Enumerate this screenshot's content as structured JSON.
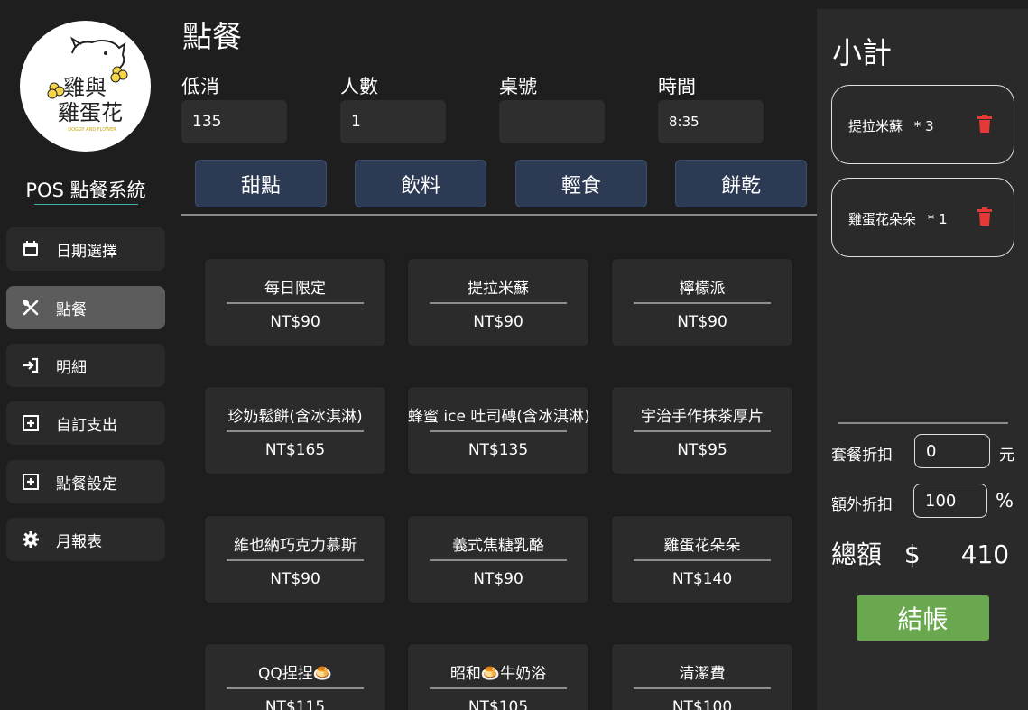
{
  "sidebar": {
    "logo_text": [
      "雞與",
      "雞蛋花"
    ],
    "logo_subtext": "DOGGY AND FLOWER",
    "title": "POS 點餐系統",
    "items": [
      {
        "label": "日期選擇",
        "icon": "calendar-icon",
        "active": false
      },
      {
        "label": "點餐",
        "icon": "utensils-icon",
        "active": true
      },
      {
        "label": "明細",
        "icon": "sign-in-icon",
        "active": false
      },
      {
        "label": "自訂支出",
        "icon": "plus-square-icon",
        "active": false
      },
      {
        "label": "點餐設定",
        "icon": "plus-square-icon",
        "active": false
      },
      {
        "label": "月報表",
        "icon": "gear-icon",
        "active": false
      }
    ]
  },
  "main": {
    "title": "點餐",
    "fields": [
      {
        "label": "低消",
        "value": "135"
      },
      {
        "label": "人數",
        "value": "1"
      },
      {
        "label": "桌號",
        "value": ""
      },
      {
        "label": "時間",
        "value": "8:35"
      }
    ],
    "categories": [
      "甜點",
      "飲料",
      "輕食",
      "餅乾"
    ],
    "products": [
      {
        "name": "每日限定",
        "price": "NT$90"
      },
      {
        "name": "提拉米蘇",
        "price": "NT$90"
      },
      {
        "name": "檸檬派",
        "price": "NT$90"
      },
      {
        "name": "珍奶鬆餅(含冰淇淋)",
        "price": "NT$165"
      },
      {
        "name": "蜂蜜 ice 吐司磚(含冰淇淋)",
        "price": "NT$135"
      },
      {
        "name": "宇治手作抹茶厚片",
        "price": "NT$95"
      },
      {
        "name": "維也納巧克力慕斯",
        "price": "NT$90"
      },
      {
        "name": "義式焦糖乳酪",
        "price": "NT$90"
      },
      {
        "name": "雞蛋花朵朵",
        "price": "NT$140"
      },
      {
        "name": "QQ捏捏🍮",
        "price": "NT$115"
      },
      {
        "name": "昭和🍮牛奶浴",
        "price": "NT$105"
      },
      {
        "name": "清潔費",
        "price": "NT$100"
      }
    ]
  },
  "panel": {
    "title": "小計",
    "cart": [
      {
        "name": "提拉米蘇",
        "qty_text": "* 3"
      },
      {
        "name": "雞蛋花朵朵",
        "qty_text": "* 1"
      }
    ],
    "set_discount_label": "套餐折扣",
    "set_discount_value": "0",
    "set_discount_unit": "元",
    "extra_discount_label": "額外折扣",
    "extra_discount_value": "100",
    "extra_discount_unit": "%",
    "total_label": "總額",
    "currency": "$",
    "total_value": "410",
    "checkout_label": "結帳"
  },
  "colors": {
    "background": "#1e1e1e",
    "panel": "#2a2a2a",
    "category_button": "#2c3a54",
    "checkout": "#6aa84f",
    "trash": "#e53935",
    "active_nav": "#5c5c5c"
  }
}
